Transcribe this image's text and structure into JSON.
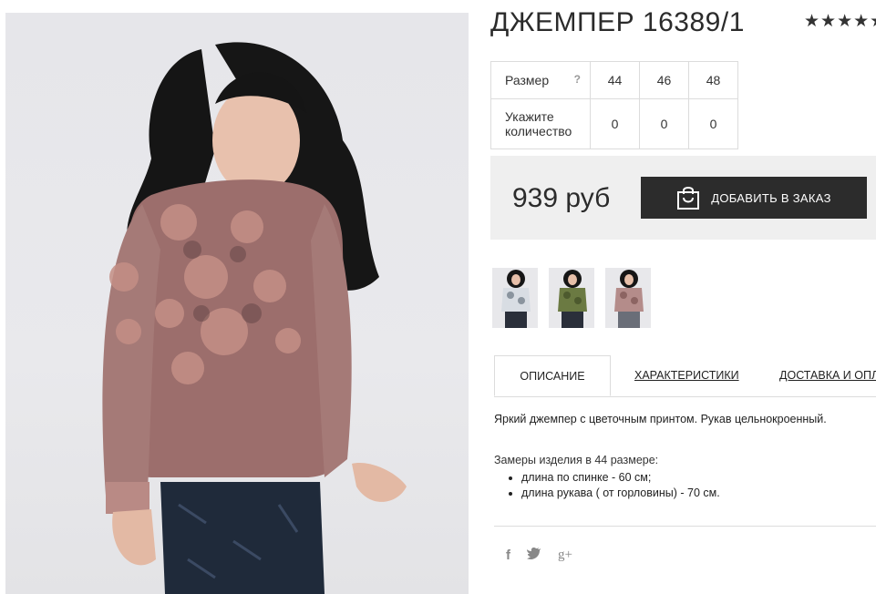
{
  "product": {
    "title": "ДЖЕМПЕР 16389/1",
    "rating_stars": "★★★★★",
    "price": "939 руб",
    "add_button_label": "ДОБАВИТЬ В ЗАКАЗ"
  },
  "size_table": {
    "size_label": "Размер",
    "help_mark": "?",
    "sizes": [
      "44",
      "46",
      "48"
    ],
    "qty_label_line1": "Укажите",
    "qty_label_line2": "количество",
    "quantities": [
      "0",
      "0",
      "0"
    ]
  },
  "thumbnails": [
    {
      "name": "white-floral-jumper"
    },
    {
      "name": "green-floral-jumper"
    },
    {
      "name": "pink-floral-jumper"
    }
  ],
  "tabs": [
    {
      "label": "ОПИСАНИЕ",
      "active": true
    },
    {
      "label": "ХАРАКТЕРИСТИКИ",
      "active": false
    },
    {
      "label": "ДОСТАВКА И ОПЛАТА",
      "active": false
    }
  ],
  "description": {
    "text": "Яркий джемпер с цветочным принтом. Рукав цельнокроенный.",
    "measurements_title": "Замеры изделия в 44 размере:",
    "measurements": [
      "длина по спинке - 60 см;",
      "длина рукава ( от горловины) - 70 см."
    ]
  },
  "social": {
    "facebook": "f",
    "twitter": "🐦",
    "google_plus": "g+"
  },
  "colors": {
    "button_bg": "#2c2c2c",
    "price_box_bg": "#efefef",
    "jumper_main": "#9c6e6c"
  }
}
